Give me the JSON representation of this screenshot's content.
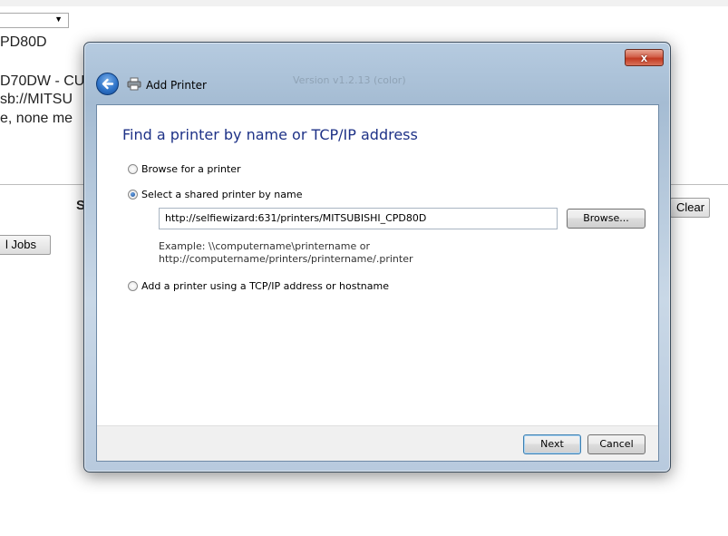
{
  "background_page": {
    "line1": "PD80D",
    "line2": "D70DW - CU",
    "line3": "sb://MITSU",
    "line4": "e, none me",
    "partial_s": "S",
    "clear_button": "Clear",
    "jobs_button": "l Jobs"
  },
  "dialog": {
    "title": "Add Printer",
    "ghost_text": "Version v1.2.13 (color)",
    "close_label": "x",
    "heading": "Find a printer by name or TCP/IP address",
    "options": [
      {
        "label": "Browse for a printer",
        "checked": false
      },
      {
        "label": "Select a shared printer by name",
        "checked": true
      },
      {
        "label": "Add a printer using a TCP/IP address or hostname",
        "checked": false
      }
    ],
    "printer_url": "http://selfiewizard:631/printers/MITSUBISHI_CPD80D",
    "browse_label": "Browse...",
    "example_line1": "Example: \\\\computername\\printername or",
    "example_line2": "http://computername/printers/printername/.printer",
    "next_label": "Next",
    "cancel_label": "Cancel"
  },
  "icons": {
    "back": "back-arrow-icon",
    "printer": "printer-icon",
    "close": "close-icon",
    "dropdown": "dropdown-arrow-icon"
  }
}
